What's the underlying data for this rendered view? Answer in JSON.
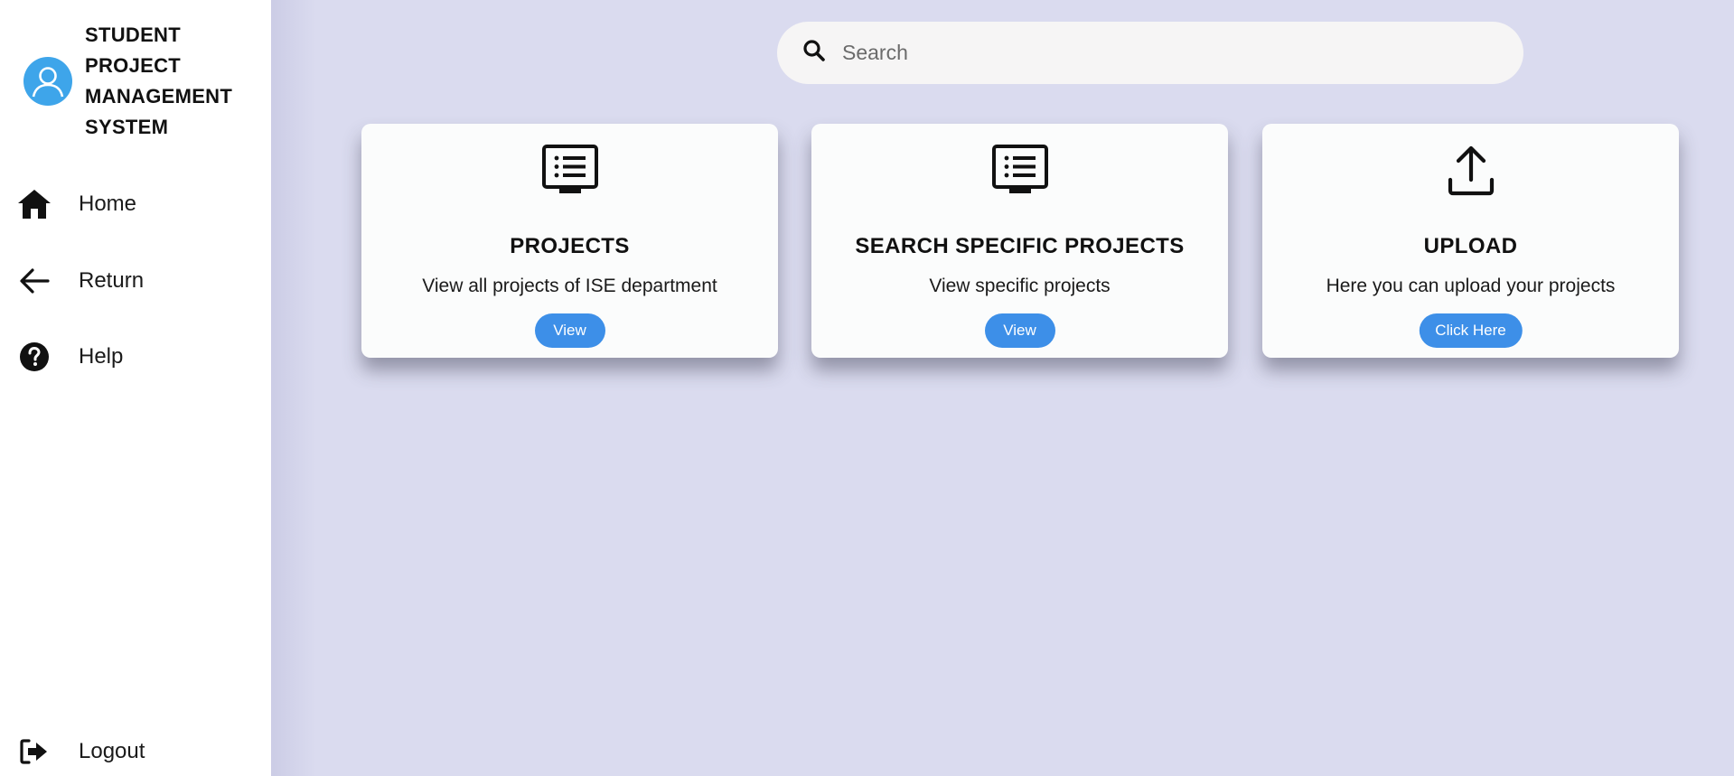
{
  "sidebar": {
    "brand": {
      "title": "STUDENT PROJECT MANAGEMENT SYSTEM",
      "avatar_icon": "user-avatar-icon",
      "avatar_color": "#3ea5ea"
    },
    "nav": {
      "home": {
        "label": "Home",
        "icon": "home-icon"
      },
      "return": {
        "label": "Return",
        "icon": "arrow-left-icon"
      },
      "help": {
        "label": "Help",
        "icon": "help-circle-icon"
      },
      "logout": {
        "label": "Logout",
        "icon": "logout-icon"
      }
    }
  },
  "search": {
    "placeholder": "Search",
    "value": "",
    "icon": "search-icon"
  },
  "cards": [
    {
      "icon": "monitor-list-icon",
      "title": "PROJECTS",
      "description": "View all projects of ISE department",
      "button_label": "View"
    },
    {
      "icon": "monitor-list-icon",
      "title": "SEARCH SPECIFIC PROJECTS",
      "description": "View specific projects",
      "button_label": "View"
    },
    {
      "icon": "upload-icon",
      "title": "UPLOAD",
      "description": "Here you can upload your projects",
      "button_label": "Click Here"
    }
  ],
  "colors": {
    "background": "#dadbef",
    "accent": "#3d8fe8",
    "card": "#fbfcfc"
  }
}
